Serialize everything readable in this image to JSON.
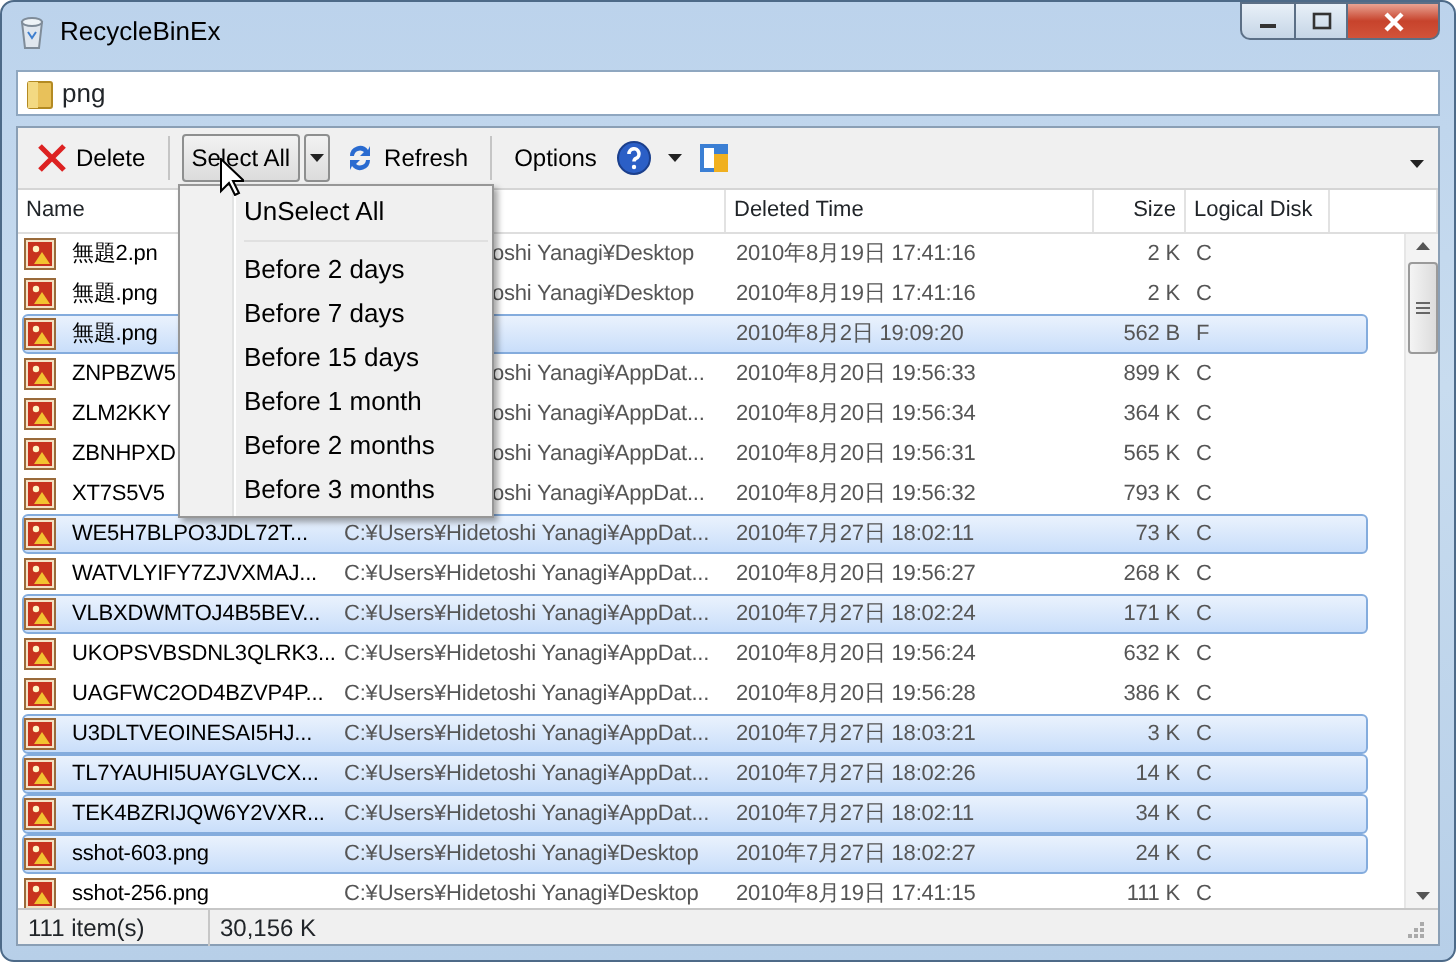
{
  "window": {
    "title": "RecycleBinEx"
  },
  "address": {
    "value": "png"
  },
  "toolbar": [
    {
      "kind": "delete",
      "label": "Delete"
    },
    {
      "kind": "split",
      "label": "Select All",
      "pressed": true
    },
    {
      "kind": "refresh",
      "label": "Refresh"
    },
    {
      "kind": "options",
      "label": "Options"
    },
    {
      "kind": "help"
    },
    {
      "kind": "app"
    }
  ],
  "columns": [
    {
      "kind": "name",
      "label": "Name"
    },
    {
      "kind": "time",
      "label": "Deleted Time"
    },
    {
      "kind": "size",
      "label": "Size"
    },
    {
      "kind": "disk",
      "label": "Logical Disk"
    }
  ],
  "rows": [
    {
      "name": "無題2.pn",
      "path": "oshi Yanagi¥Desktop",
      "path_clipped": true,
      "time": "2010年8月19日 17:41:16",
      "size": "2 K",
      "disk": "C",
      "selected": false
    },
    {
      "name": "無題.png",
      "path": "oshi Yanagi¥Desktop",
      "path_clipped": true,
      "time": "2010年8月19日 17:41:16",
      "size": "2 K",
      "disk": "C",
      "selected": false
    },
    {
      "name": "無題.png",
      "time": "2010年8月2日 19:09:20",
      "size": "562 B",
      "disk": "F",
      "selected": true
    },
    {
      "name": "ZNPBZW5",
      "path": "oshi Yanagi¥AppDat...",
      "path_clipped": true,
      "time": "2010年8月20日 19:56:33",
      "size": "899 K",
      "disk": "C",
      "selected": false
    },
    {
      "name": "ZLM2KKY",
      "path": "oshi Yanagi¥AppDat...",
      "path_clipped": true,
      "time": "2010年8月20日 19:56:34",
      "size": "364 K",
      "disk": "C",
      "selected": false
    },
    {
      "name": "ZBNHPXD",
      "path": "oshi Yanagi¥AppDat...",
      "path_clipped": true,
      "time": "2010年8月20日 19:56:31",
      "size": "565 K",
      "disk": "C",
      "selected": false
    },
    {
      "name": "XT7S5V5",
      "path": "oshi Yanagi¥AppDat...",
      "path_clipped": true,
      "time": "2010年8月20日 19:56:32",
      "size": "793 K",
      "disk": "C",
      "selected": false
    },
    {
      "name": "WE5H7BLPO3JDL72T...",
      "path": "C:¥Users¥Hidetoshi Yanagi¥AppDat...",
      "path_clipped": false,
      "time": "2010年7月27日 18:02:11",
      "size": "73 K",
      "disk": "C",
      "selected": true
    },
    {
      "name": "WATVLYIFY7ZJVXMAJ...",
      "path": "C:¥Users¥Hidetoshi Yanagi¥AppDat...",
      "path_clipped": false,
      "time": "2010年8月20日 19:56:27",
      "size": "268 K",
      "disk": "C",
      "selected": false
    },
    {
      "name": "VLBXDWMTOJ4B5BEV...",
      "path": "C:¥Users¥Hidetoshi Yanagi¥AppDat...",
      "path_clipped": false,
      "time": "2010年7月27日 18:02:24",
      "size": "171 K",
      "disk": "C",
      "selected": true
    },
    {
      "name": "UKOPSVBSDNL3QLRK3...",
      "path": "C:¥Users¥Hidetoshi Yanagi¥AppDat...",
      "path_clipped": false,
      "time": "2010年8月20日 19:56:24",
      "size": "632 K",
      "disk": "C",
      "selected": false
    },
    {
      "name": "UAGFWC2OD4BZVP4P...",
      "path": "C:¥Users¥Hidetoshi Yanagi¥AppDat...",
      "path_clipped": false,
      "time": "2010年8月20日 19:56:28",
      "size": "386 K",
      "disk": "C",
      "selected": false
    },
    {
      "name": "U3DLTVEOINESAI5HJ...",
      "path": "C:¥Users¥Hidetoshi Yanagi¥AppDat...",
      "path_clipped": false,
      "time": "2010年7月27日 18:03:21",
      "size": "3 K",
      "disk": "C",
      "selected": true
    },
    {
      "name": "TL7YAUHI5UAYGLVCX...",
      "path": "C:¥Users¥Hidetoshi Yanagi¥AppDat...",
      "path_clipped": false,
      "time": "2010年7月27日 18:02:26",
      "size": "14 K",
      "disk": "C",
      "selected": true
    },
    {
      "name": "TEK4BZRIJQW6Y2VXR...",
      "path": "C:¥Users¥Hidetoshi Yanagi¥AppDat...",
      "path_clipped": false,
      "time": "2010年7月27日 18:02:11",
      "size": "34 K",
      "disk": "C",
      "selected": true
    },
    {
      "name": "sshot-603.png",
      "path": "C:¥Users¥Hidetoshi Yanagi¥Desktop",
      "path_clipped": false,
      "time": "2010年7月27日 18:02:27",
      "size": "24 K",
      "disk": "C",
      "selected": true
    },
    {
      "name": "sshot-256.png",
      "path": "C:¥Users¥Hidetoshi Yanagi¥Desktop",
      "path_clipped": false,
      "time": "2010年8月19日 17:41:15",
      "size": "111 K",
      "disk": "C",
      "selected": false
    }
  ],
  "menu": [
    {
      "label": "UnSelect All",
      "separator_after": true
    },
    {
      "label": "Before 2 days"
    },
    {
      "label": "Before 7 days"
    },
    {
      "label": "Before 15 days"
    },
    {
      "label": "Before 1 month"
    },
    {
      "label": "Before 2 months"
    },
    {
      "label": "Before 3 months"
    }
  ],
  "status_bar": {
    "count": "111 item(s)",
    "total": "30,156 K"
  }
}
